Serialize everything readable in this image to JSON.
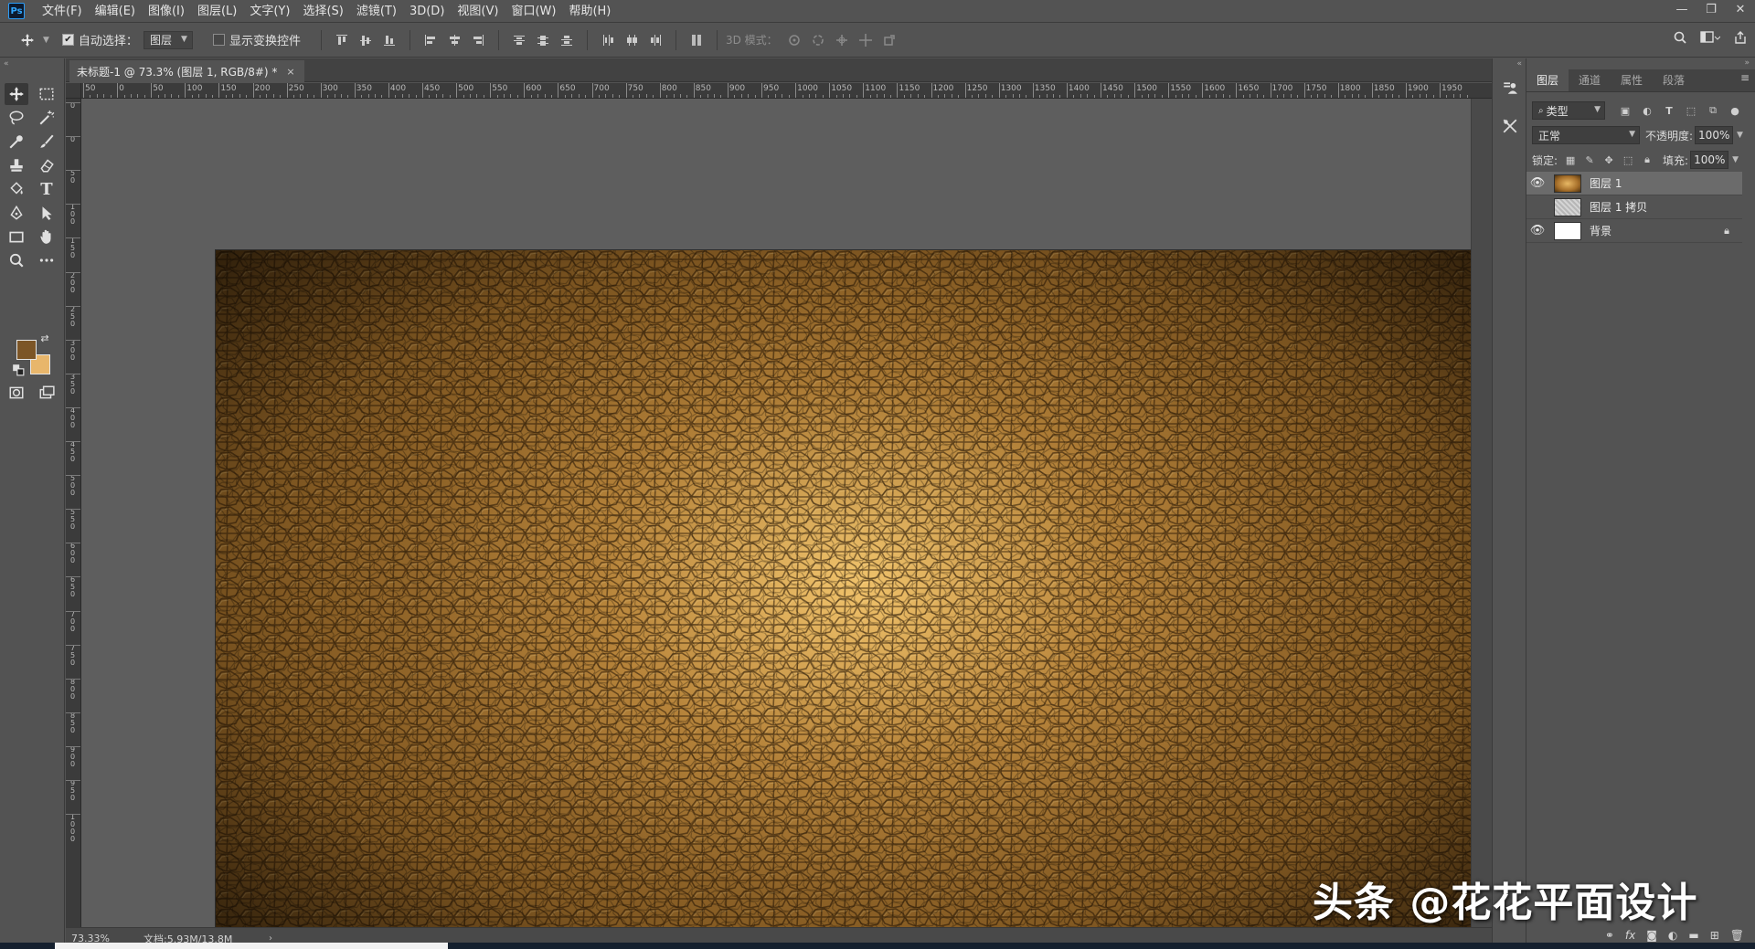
{
  "app": {
    "logo_text": "Ps"
  },
  "menu": [
    "文件(F)",
    "编辑(E)",
    "图像(I)",
    "图层(L)",
    "文字(Y)",
    "选择(S)",
    "滤镜(T)",
    "3D(D)",
    "视图(V)",
    "窗口(W)",
    "帮助(H)"
  ],
  "window_controls": {
    "minimize": "—",
    "restore": "❐",
    "close": "✕"
  },
  "options": {
    "auto_select_label": "自动选择：",
    "auto_select_checked": true,
    "target_value": "图层",
    "show_transform_label": "显示变换控件",
    "show_transform_checked": false,
    "mode_3d_label": "3D 模式："
  },
  "document_tab": {
    "title": "未标题-1 @ 73.3% (图层 1, RGB/8#) *",
    "close": "×"
  },
  "ruler": {
    "h_labels": [
      "50",
      "0",
      "50",
      "100",
      "150",
      "200",
      "250",
      "300",
      "350",
      "400",
      "450",
      "500",
      "550",
      "600",
      "650",
      "700",
      "750",
      "800",
      "850",
      "900",
      "950",
      "1000",
      "1050",
      "1100",
      "1150",
      "1200",
      "1250",
      "1300",
      "1350",
      "1400",
      "1450",
      "1500",
      "1550",
      "1600",
      "1650",
      "1700",
      "1750",
      "1800",
      "1850",
      "1900",
      "1950"
    ],
    "v_labels": [
      "0",
      "0",
      "50",
      "100",
      "150",
      "200",
      "250",
      "300",
      "350",
      "400",
      "450",
      "500",
      "550",
      "600",
      "650",
      "700",
      "750",
      "800",
      "850",
      "900",
      "950",
      "1000"
    ]
  },
  "status": {
    "zoom": "73.33%",
    "doc_info": "文档:5.93M/13.8M",
    "arrow": "›"
  },
  "panel": {
    "tabs": [
      "图层",
      "通道",
      "属性",
      "段落"
    ],
    "active_tab": "图层",
    "filter_kind": "类型",
    "blend_mode": "正常",
    "opacity_label": "不透明度:",
    "opacity_value": "100%",
    "lock_label": "锁定:",
    "fill_label": "填充:",
    "fill_value": "100%",
    "layers": [
      {
        "name": "图层 1",
        "visible": true,
        "selected": true,
        "thumb": "gold"
      },
      {
        "name": "图层 1 拷贝",
        "visible": false,
        "selected": false,
        "thumb": "texture"
      },
      {
        "name": "背景",
        "visible": true,
        "selected": false,
        "thumb": "white",
        "locked": true
      }
    ]
  },
  "colors": {
    "foreground": "#7c5526",
    "background": "#e8b66b",
    "canvas_center": "#e8b865",
    "canvas_edge": "#5a3b14"
  },
  "watermark": "头条 @花花平面设计"
}
